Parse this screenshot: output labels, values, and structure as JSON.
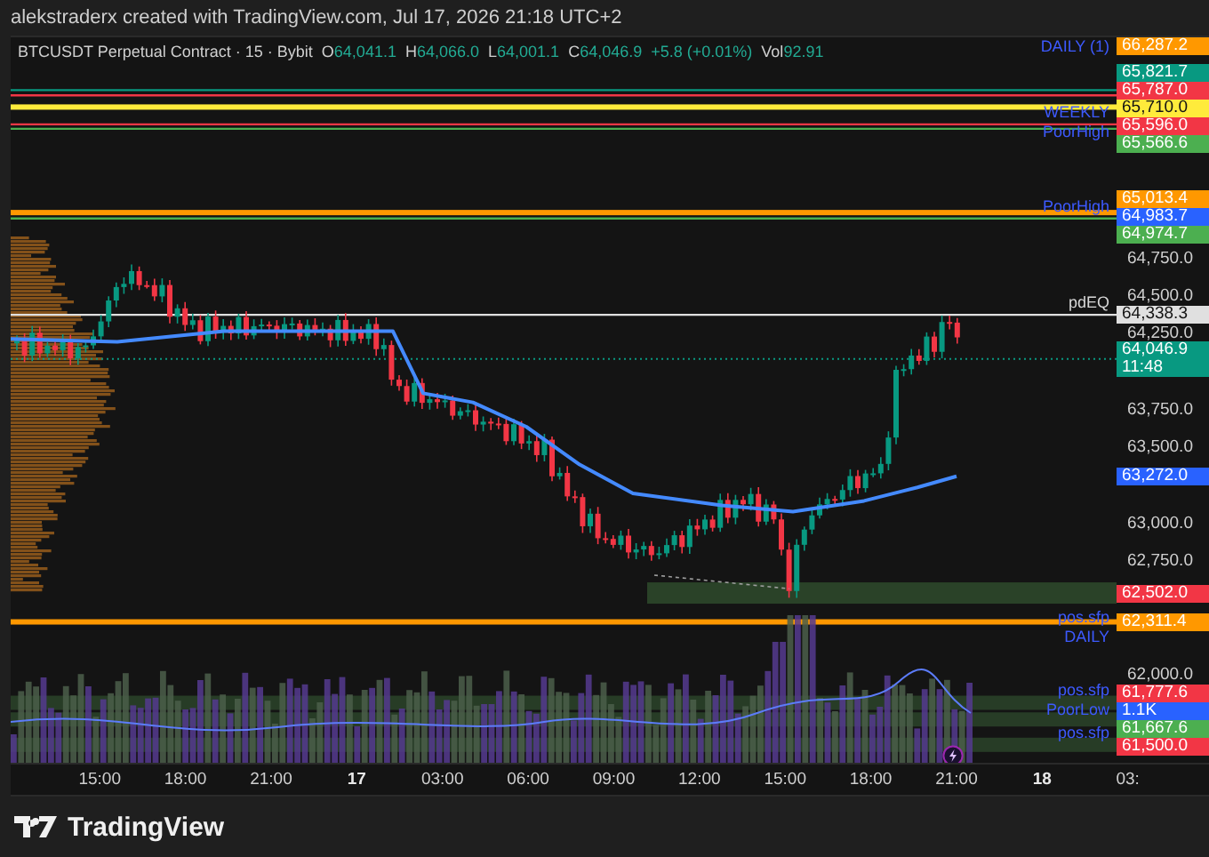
{
  "header": {
    "text": "alekstraderx created with TradingView.com, Jul 17, 2026 21:18 UTC+2"
  },
  "legend": {
    "symbol": "BTCUSDT Perpetual Contract · 15 · Bybit",
    "fields": [
      {
        "label": "O",
        "value": "64,041.1"
      },
      {
        "label": "H",
        "value": "64,066.0"
      },
      {
        "label": "L",
        "value": "64,001.1"
      },
      {
        "label": "C",
        "value": "64,046.9"
      },
      {
        "value": "+5.8 (+0.01%)"
      },
      {
        "label": "Vol",
        "value": "92.91"
      }
    ]
  },
  "price_ticks": [
    "64,750.0",
    "64,500.0",
    "64,250.0",
    "63,750.0",
    "63,500.0",
    "63,000.0",
    "62,750.0",
    "62,000.0"
  ],
  "price_tags": [
    {
      "text": "66,287.2",
      "color": "#ff9800",
      "kind": "plain",
      "note": "DAILY (1)"
    },
    {
      "text": "65,821.7",
      "color": "#089981",
      "kind": "thin"
    },
    {
      "text": "65,787.0",
      "color": "#f23645",
      "kind": "thin"
    },
    {
      "text": "65,710.0",
      "color": "#ffeb3b",
      "kind": "thick"
    },
    {
      "text": "65,596.0",
      "color": "#f23645",
      "kind": "thin",
      "note": "WEEKLY"
    },
    {
      "text": "65,566.6",
      "color": "#4caf50",
      "kind": "thin",
      "note": "PoorHigh"
    },
    {
      "text": "65,013.4",
      "color": "#ff9800",
      "kind": "thick"
    },
    {
      "text": "64,983.7",
      "color": "#2962ff",
      "kind": "plain"
    },
    {
      "text": "64,974.7",
      "color": "#4caf50",
      "kind": "thin",
      "note": "PoorHigh"
    },
    {
      "text": "64,338.3",
      "color": "#e0e0e0",
      "kind": "thin",
      "note": "pdEQ"
    },
    {
      "text": "64,046.9",
      "sub": "11:48",
      "color": "#089981",
      "kind": "dotted"
    },
    {
      "text": "63,272.0",
      "color": "#2962ff",
      "kind": "plain"
    },
    {
      "text": "62,502.0",
      "color": "#f23645",
      "kind": "zone-right",
      "note": "pos.sfp"
    },
    {
      "text": "62,311.4",
      "color": "#ff9800",
      "kind": "thick",
      "note": "DAILY"
    },
    {
      "text": "61,777.6",
      "color": "#f23645",
      "kind": "zone",
      "note": "pos.sfp"
    },
    {
      "text": "1.1K",
      "color": "#2962ff",
      "kind": "volume"
    },
    {
      "text": "61,667.6",
      "color": "#4caf50",
      "kind": "zone",
      "note": "PoorLow"
    },
    {
      "text": "61,500.0",
      "color": "#f23645",
      "kind": "zone",
      "note": "pos.sfp"
    }
  ],
  "time_axis": [
    {
      "text": "15:00",
      "kind": "time"
    },
    {
      "text": "18:00",
      "kind": "time"
    },
    {
      "text": "21:00",
      "kind": "time"
    },
    {
      "text": "17",
      "kind": "day"
    },
    {
      "text": "03:00",
      "kind": "time"
    },
    {
      "text": "06:00",
      "kind": "time"
    },
    {
      "text": "09:00",
      "kind": "time"
    },
    {
      "text": "12:00",
      "kind": "time"
    },
    {
      "text": "15:00",
      "kind": "time"
    },
    {
      "text": "18:00",
      "kind": "time"
    },
    {
      "text": "21:00",
      "kind": "time"
    },
    {
      "text": "18",
      "kind": "day"
    },
    {
      "text": "03:",
      "kind": "time"
    }
  ],
  "footer": {
    "brand": "TradingView"
  }
}
